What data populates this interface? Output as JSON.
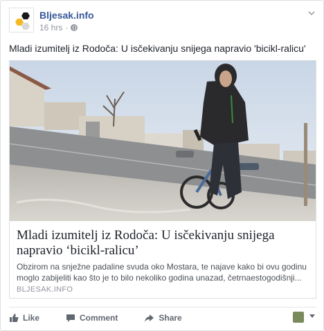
{
  "page": {
    "name": "Bljesak.info",
    "time": "16 hrs",
    "separator": "·",
    "privacy_icon": "globe-icon"
  },
  "post": {
    "caption": "Mladi izumitelj iz Rodoča: U isčekivanju snijega napravio 'bicikl-ralicu'"
  },
  "link": {
    "title": "Mladi izumitelj iz Rodoča: U isčekivanju snijega napravio ‘bicikl-ralicu’",
    "description": "Obzirom na snježne padaline svuda oko Mostara, te najave kako bi ovu godinu moglo zabijeliti kao što je to bilo nekoliko godina unazad, četrnaestogodišnji...",
    "domain": "BLJESAK.INFO"
  },
  "actions": {
    "like": "Like",
    "comment": "Comment",
    "share": "Share"
  },
  "colors": {
    "link_blue": "#365899",
    "meta_gray": "#90949c",
    "action_gray": "#616770",
    "logo_yellow": "#f5b923",
    "logo_black": "#1a1a1a"
  }
}
